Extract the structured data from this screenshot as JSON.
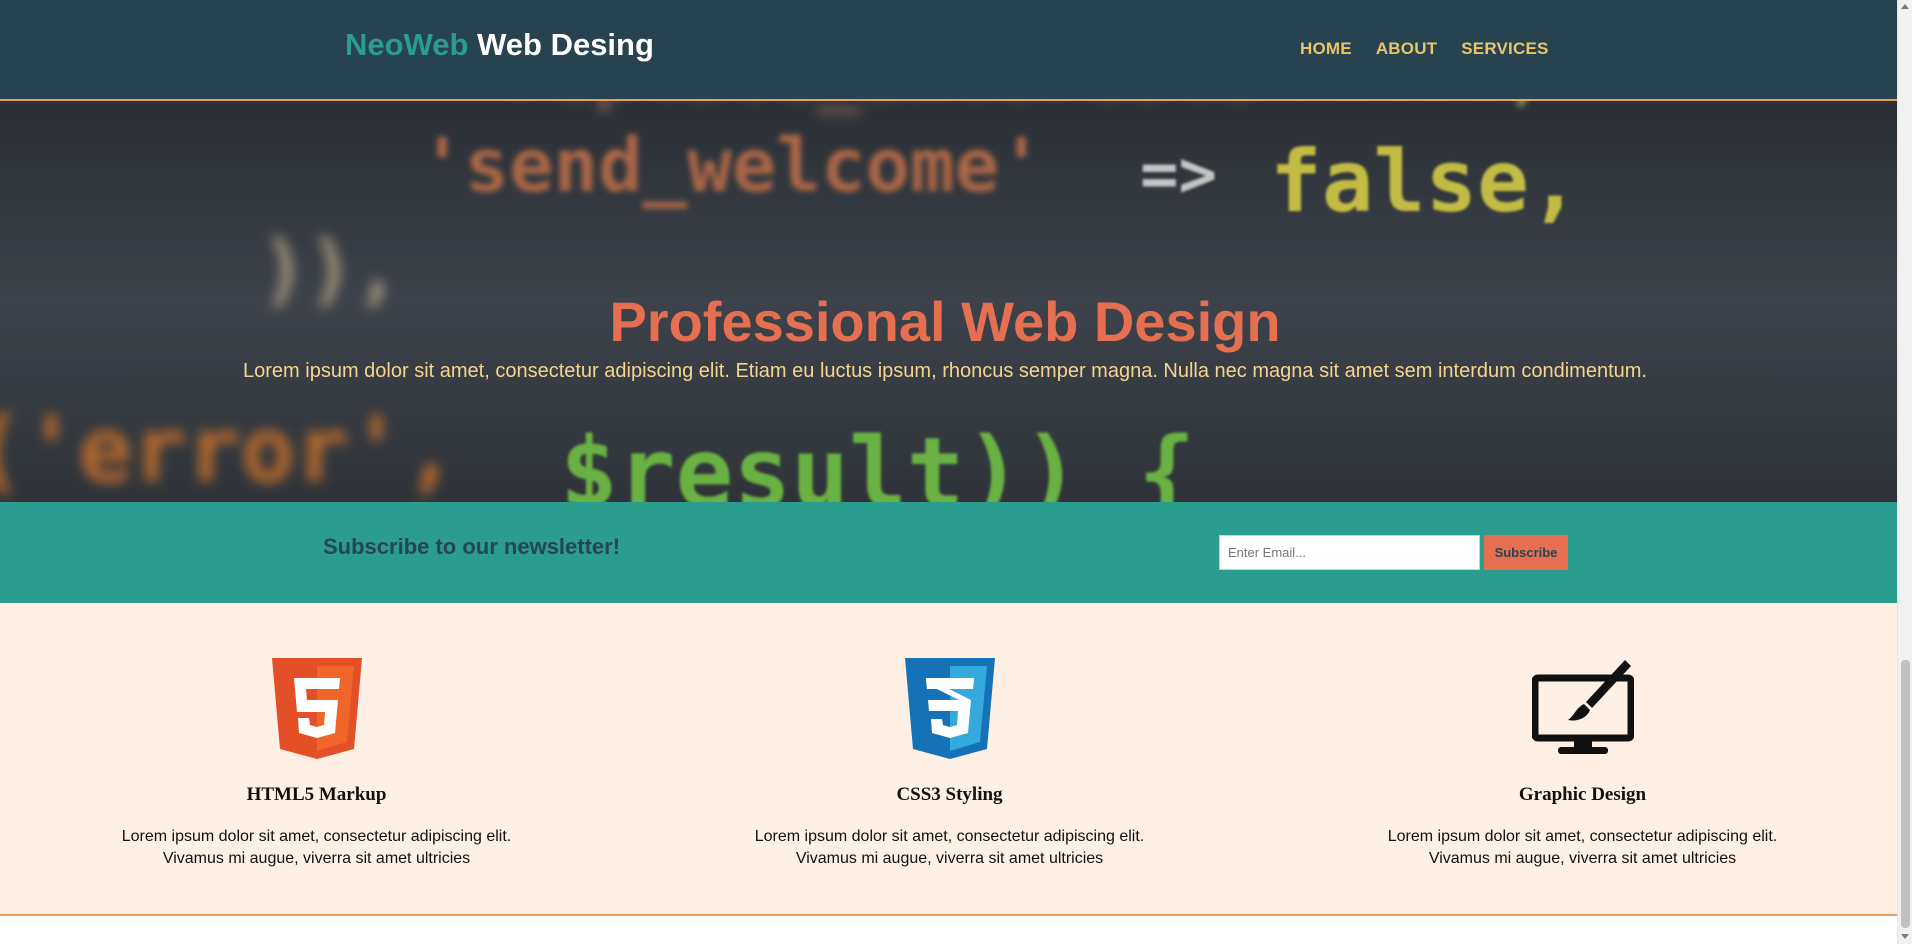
{
  "header": {
    "brand_highlight": "NeoWeb",
    "brand_rest": "Web Desing",
    "nav": [
      {
        "label": "HOME"
      },
      {
        "label": "ABOUT"
      },
      {
        "label": "SERVICES"
      }
    ]
  },
  "hero": {
    "title": "Professional Web Design",
    "text": "Lorem ipsum dolor sit amet, consectetur adipiscing elit. Etiam eu luctus ipsum, rhoncus semper magna. Nulla nec magna sit amet sem interdum condimentum.",
    "background_code": {
      "line1": "'send_welcome'",
      "arrow": "=>",
      "value": "false,",
      "line2": ")),",
      "line3a": "('error',",
      "line3b": "$result)) {"
    }
  },
  "newsletter": {
    "title": "Subscribe to our newsletter!",
    "email_placeholder": "Enter Email...",
    "email_value": "",
    "button_label": "Subscribe"
  },
  "features": [
    {
      "icon": "html5-icon",
      "title": "HTML5 Markup",
      "line1": "Lorem ipsum dolor sit amet, consectetur adipiscing elit.",
      "line2": "Vivamus mi augue, viverra sit amet ultricies"
    },
    {
      "icon": "css3-icon",
      "title": "CSS3 Styling",
      "line1": "Lorem ipsum dolor sit amet, consectetur adipiscing elit.",
      "line2": "Vivamus mi augue, viverra sit amet ultricies"
    },
    {
      "icon": "graphic-design-monitor-icon",
      "title": "Graphic Design",
      "line1": "Lorem ipsum dolor sit amet, consectetur adipiscing elit.",
      "line2": "Vivamus mi augue, viverra sit amet ultricies"
    }
  ],
  "colors": {
    "header_bg": "#27434f",
    "brand_accent": "#2a9d8f",
    "nav_text": "#e9c46a",
    "hero_title": "#e76f51",
    "hero_text": "#f4d58d",
    "newsletter_bg": "#2a9d8f",
    "features_bg": "#fff0e5",
    "border_accent": "#e8a05a"
  }
}
